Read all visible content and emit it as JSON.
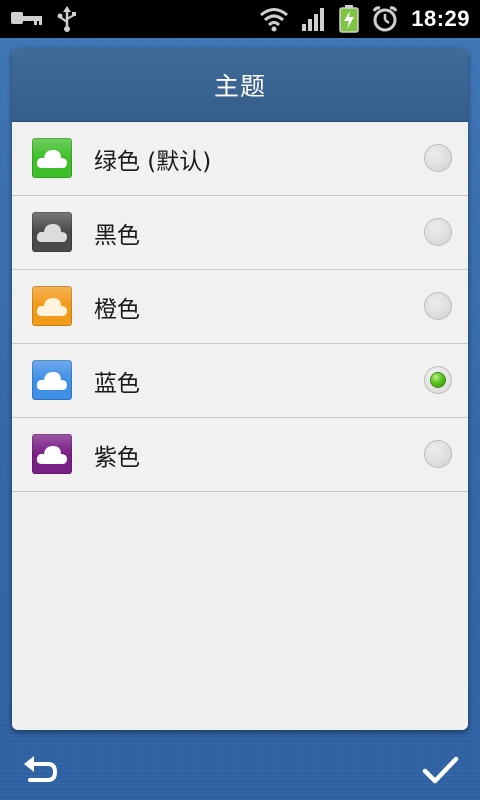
{
  "status_bar": {
    "time": "18:29",
    "icons": [
      "key-icon",
      "usb-icon",
      "wifi-icon",
      "signal-icon",
      "battery-charging-icon",
      "alarm-icon"
    ]
  },
  "dialog": {
    "title": "主题",
    "items": [
      {
        "label": "绿色 (默认)",
        "color": "#3fbf2a",
        "selected": false
      },
      {
        "label": "黑色",
        "color": "#4a4a4a",
        "selected": false
      },
      {
        "label": "橙色",
        "color": "#f29a1a",
        "selected": false
      },
      {
        "label": "蓝色",
        "color": "#3f8fe6",
        "selected": true
      },
      {
        "label": "紫色",
        "color": "#7a1f86",
        "selected": false
      }
    ]
  },
  "bottom_bar": {
    "back_icon": "undo-icon",
    "confirm_icon": "check-icon"
  }
}
